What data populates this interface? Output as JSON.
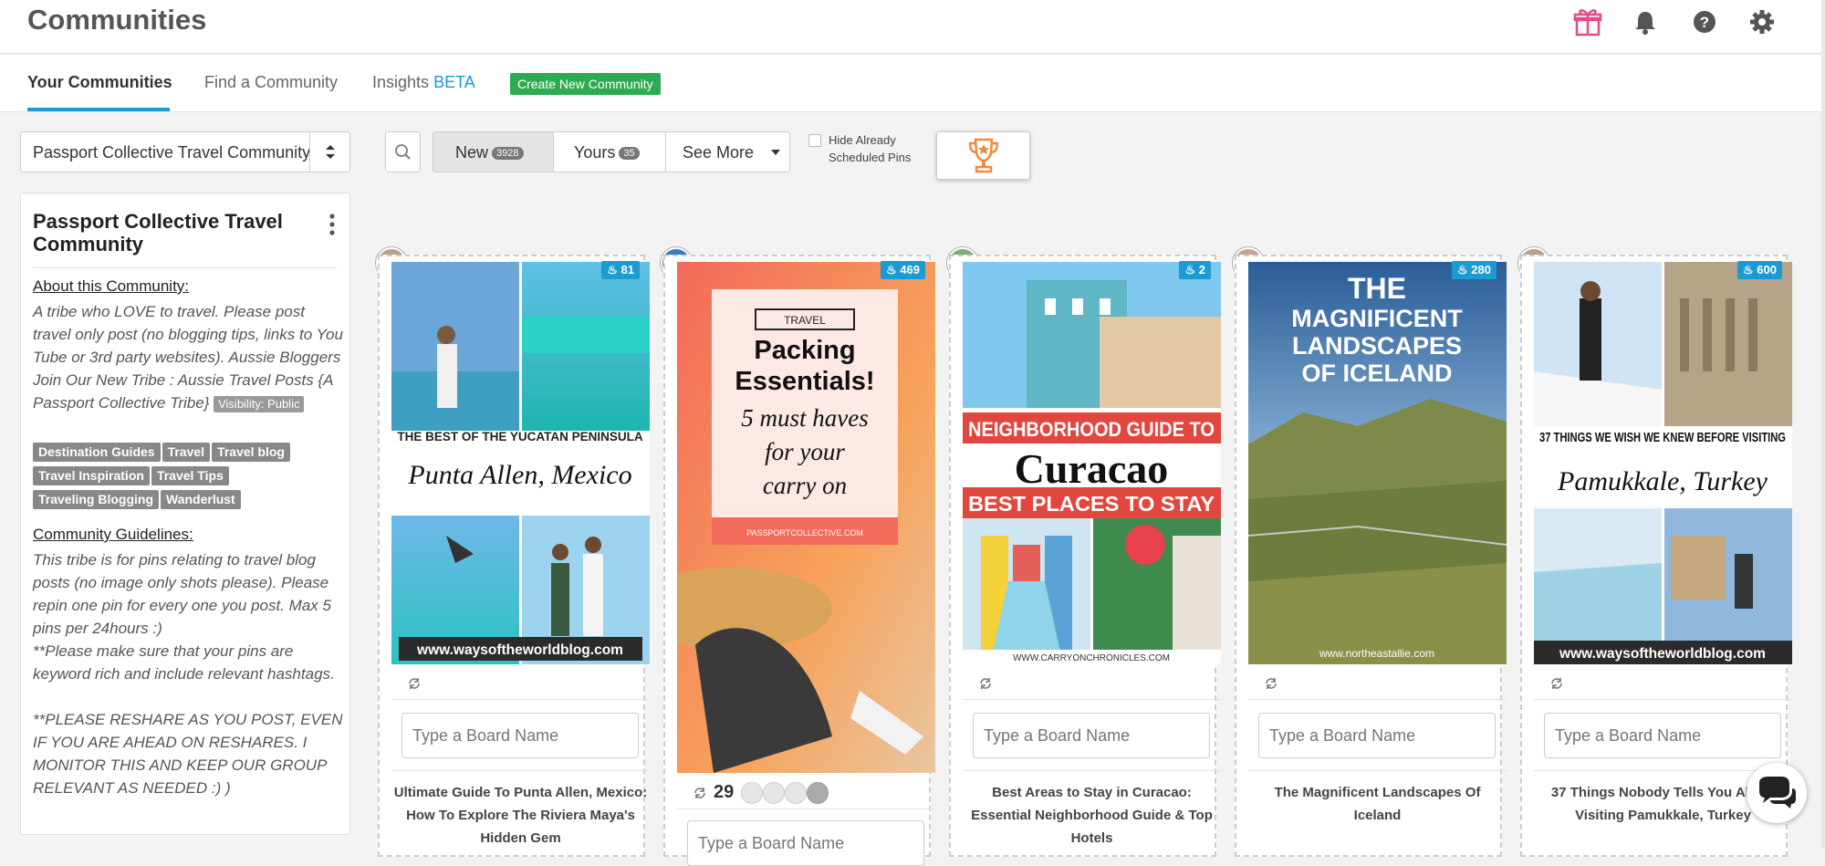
{
  "header": {
    "title": "Communities",
    "icons": [
      "gift-icon",
      "bell-icon",
      "help-icon",
      "gear-icon"
    ]
  },
  "tabs": [
    {
      "label": "Your Communities",
      "active": true
    },
    {
      "label": "Find a Community"
    },
    {
      "label": "Insights",
      "tag": "BETA"
    }
  ],
  "create_button": "Create New Community",
  "stats": [
    {
      "icon": "users-icon",
      "value": "∞"
    },
    {
      "icon": "grid-plus-icon",
      "value": "∞"
    }
  ],
  "filters": {
    "community_select": "Passport Collective Travel Community",
    "segments": [
      {
        "label": "New",
        "count": "3928",
        "active": true
      },
      {
        "label": "Yours",
        "count": "35"
      },
      {
        "label": "See More"
      }
    ],
    "hide_scheduled_label": "Hide Already Scheduled Pins",
    "hide_scheduled_checked": false
  },
  "sidebar": {
    "title": "Passport Collective Travel Community",
    "about_heading": "About this Community:",
    "about_text": "A tribe who LOVE to travel. Please post travel only post (no blogging tips, links to You Tube or 3rd party websites). Aussie Bloggers Join Our New Tribe : Aussie Travel Posts {A Passport Collective Tribe}",
    "visibility": "Visibility: Public",
    "tags": [
      "Destination Guides",
      "Travel",
      "Travel blog",
      "Travel Inspiration",
      "Travel Tips",
      "Traveling Blogging",
      "Wanderlust"
    ],
    "guidelines_heading": "Community Guidelines:",
    "guidelines_text": "This tribe is for pins relating to travel blog posts (no image only shots please). Please repin one pin for every one you post. Max 5 pins per 24hours  :)\n**Please make sure that your pins are keyword rich and include relevant hashtags.\n\n**PLEASE RESHARE AS YOU POST, EVEN IF YOU ARE AHEAD ON RESHARES. I MONITOR THIS AND KEEP OUR GROUP RELEVANT AS NEEDED :)  )"
  },
  "board_placeholder": "Type a Board Name",
  "pins": [
    {
      "count": "81",
      "title": "Ultimate Guide To Punta Allen, Mexico: How To Explore The Riviera Maya's Hidden Gem",
      "img_banner": "THE BEST OF THE YUCATAN PENINSULA",
      "img_script": "Punta Allen, Mexico",
      "img_footer": "www.waysoftheworldblog.com"
    },
    {
      "count": "469",
      "repins": "29",
      "img_tag": "TRAVEL",
      "img_line1": "Packing",
      "img_line2": "Essentials!",
      "img_line3": "5 must haves",
      "img_line4": "for your",
      "img_line5": "carry on",
      "img_footer": "PASSPORTCOLLECTIVE.COM"
    },
    {
      "count": "2",
      "title": "Best Areas to Stay in Curacao: Essential Neighborhood Guide & Top Hotels",
      "img_line1": "NEIGHBORHOOD GUIDE TO",
      "img_line2": "Curacao",
      "img_line3": "BEST PLACES TO STAY",
      "img_footer": "WWW.CARRYONCHRONICLES.COM"
    },
    {
      "count": "280",
      "title": "The Magnificent Landscapes Of Iceland",
      "img_line1": "THE",
      "img_line2": "MAGNIFICENT",
      "img_line3": "LANDSCAPES",
      "img_line4": "OF ICELAND",
      "img_footer": "www.northeastallie.com"
    },
    {
      "count": "600",
      "title": "37 Things Nobody Tells You About Visiting Pamukkale, Turkey",
      "img_banner": "37 THINGS WE WISH WE KNEW BEFORE VISITING",
      "img_script": "Pamukkale, Turkey",
      "img_footer": "www.waysoftheworldblog.com"
    }
  ],
  "colors": {
    "accent": "#1b9bd1",
    "create": "#2eaa52",
    "badge": "#1b9bd1",
    "gift": "#e24a8a"
  }
}
